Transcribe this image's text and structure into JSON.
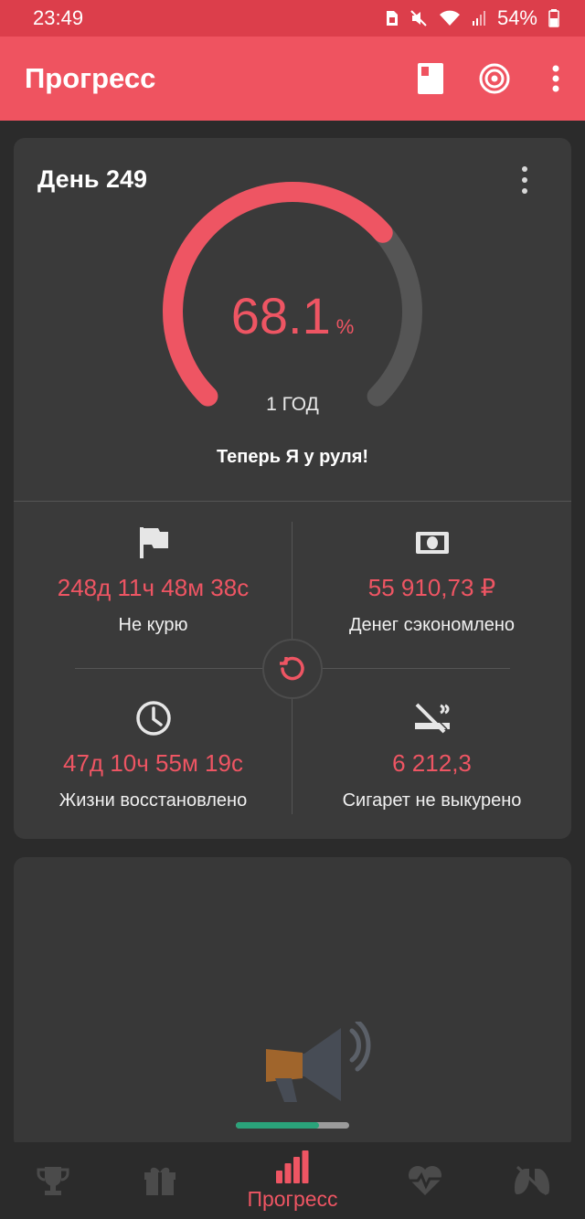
{
  "status_bar": {
    "time": "23:49",
    "battery": "54%"
  },
  "app_bar": {
    "title": "Прогресс"
  },
  "progress_card": {
    "day_label": "День 249",
    "percent_value": "68.1",
    "percent_sign": "%",
    "progress_fraction": 0.681,
    "goal_label": "1 ГОД",
    "motto": "Теперь Я у руля!",
    "stats": [
      {
        "value": "248д 11ч 48м 38с",
        "label": "Не курю",
        "icon": "flag-icon"
      },
      {
        "value": "55 910,73 ₽",
        "label": "Денег сэкономлено",
        "icon": "money-icon"
      },
      {
        "value": "47д 10ч 55м 19с",
        "label": "Жизни восстановлено",
        "icon": "clock-icon"
      },
      {
        "value": "6 212,3",
        "label": "Сигарет не выкурено",
        "icon": "no-smoking-icon"
      }
    ]
  },
  "ad_card": {
    "loading_fraction": 0.73
  },
  "bottom_nav": {
    "items": [
      {
        "icon": "trophy-icon"
      },
      {
        "icon": "gift-icon"
      },
      {
        "icon": "bar-chart-icon",
        "label": "Прогресс",
        "active": true
      },
      {
        "icon": "heart-pulse-icon"
      },
      {
        "icon": "lungs-icon"
      }
    ]
  },
  "colors": {
    "accent": "#ee5563",
    "app_bar": "#ef5360",
    "status_bar": "#dc3e4b",
    "card": "#3a3a3a",
    "track": "#555555",
    "ad_progress": "#2aa37a"
  }
}
